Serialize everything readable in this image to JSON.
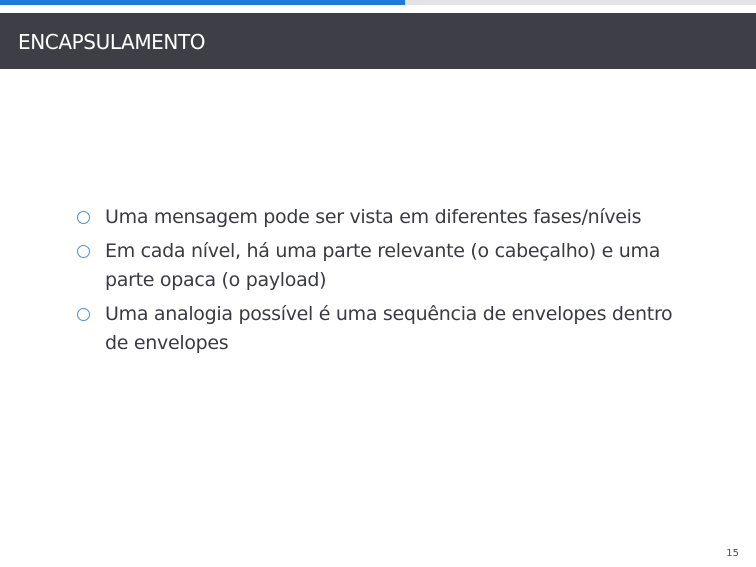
{
  "slide": {
    "title": "ENCAPSULAMENTO",
    "progress_fraction": 0.536,
    "page_number": "15"
  },
  "colors": {
    "title_bar": "#3e3f46",
    "progress": "#1f7ad9",
    "progress_track": "#e3e3e6",
    "bullet_marker": "#4a90d9"
  },
  "bullets": [
    {
      "text": "Uma mensagem pode ser vista em diferentes fases/níveis",
      "icon": "circle-outline-icon"
    },
    {
      "text": "Em cada nível, há uma parte relevante (o cabeçalho) e uma parte opaca (o payload)",
      "icon": "circle-outline-icon"
    },
    {
      "text": "Uma analogia possível é uma sequência de envelopes dentro de envelopes",
      "icon": "circle-outline-icon"
    }
  ]
}
